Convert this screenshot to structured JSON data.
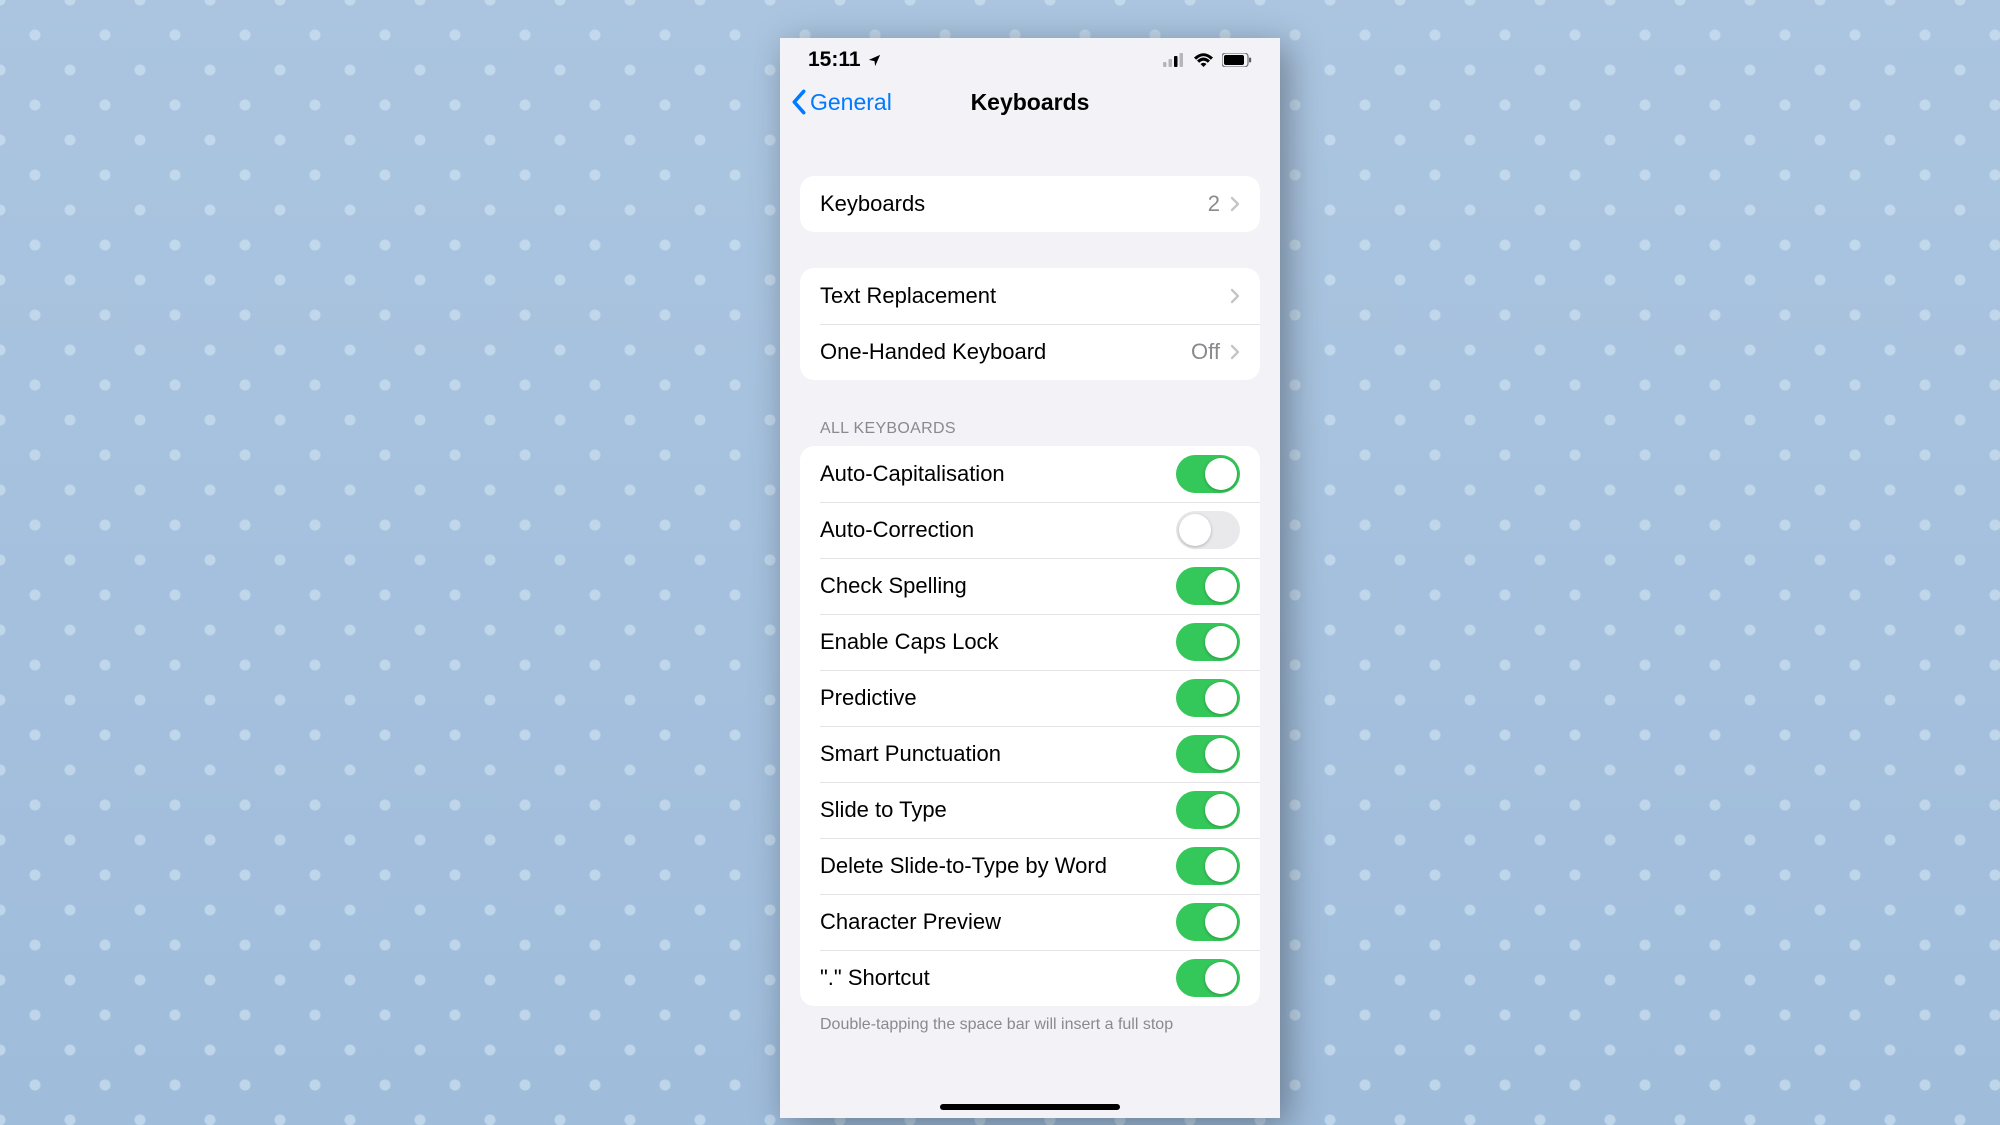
{
  "status_bar": {
    "time": "15:11"
  },
  "nav": {
    "back_label": "General",
    "title": "Keyboards"
  },
  "groups": {
    "g1": {
      "keyboards_label": "Keyboards",
      "keyboards_count": "2"
    },
    "g2": {
      "text_replacement_label": "Text Replacement",
      "one_handed_label": "One-Handed Keyboard",
      "one_handed_value": "Off"
    },
    "section_header": "ALL KEYBOARDS",
    "toggles": [
      {
        "label": "Auto-Capitalisation",
        "on": true
      },
      {
        "label": "Auto-Correction",
        "on": false
      },
      {
        "label": "Check Spelling",
        "on": true
      },
      {
        "label": "Enable Caps Lock",
        "on": true
      },
      {
        "label": "Predictive",
        "on": true
      },
      {
        "label": "Smart Punctuation",
        "on": true
      },
      {
        "label": "Slide to Type",
        "on": true
      },
      {
        "label": "Delete Slide-to-Type by Word",
        "on": true
      },
      {
        "label": "Character Preview",
        "on": true
      },
      {
        "label": "\".\" Shortcut",
        "on": true
      }
    ],
    "footer": "Double-tapping the space bar will insert a full stop"
  }
}
